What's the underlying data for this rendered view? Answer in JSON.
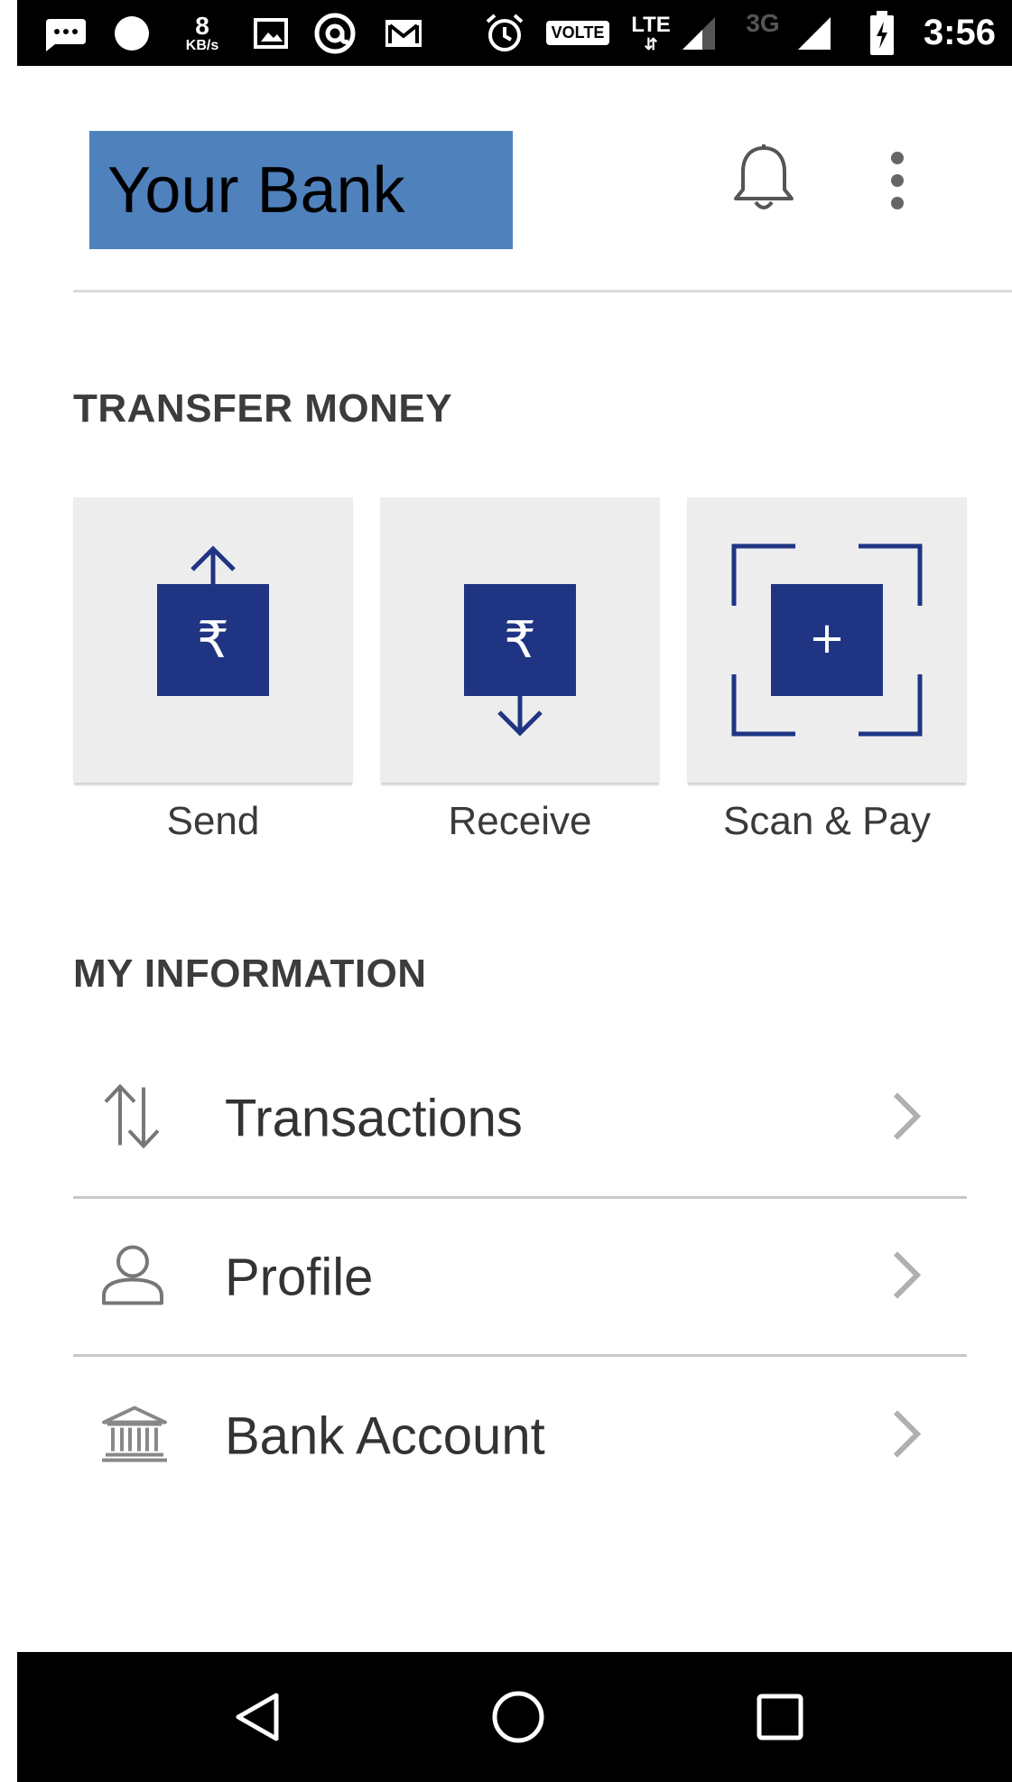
{
  "status_bar": {
    "network_speed_value": "8",
    "network_speed_unit": "KB/s",
    "volte_label": "VOLTE",
    "lte_label": "LTE",
    "secondary_network_label": "3G",
    "time": "3:56",
    "icons": [
      "message-icon",
      "circle-notification-icon",
      "image-icon",
      "at-sign-icon",
      "gmail-icon",
      "alarm-icon",
      "signal-icon",
      "battery-charging-icon"
    ]
  },
  "header": {
    "brand_name": "Your Bank",
    "brand_color": "#4f81bd",
    "icons": [
      "bell-icon",
      "more-vertical-icon"
    ]
  },
  "transfer_section": {
    "title": "TRANSFER MONEY",
    "tiles": [
      {
        "label": "Send",
        "icon": "send-rupee-icon",
        "symbol": "₹"
      },
      {
        "label": "Receive",
        "icon": "receive-rupee-icon",
        "symbol": "₹"
      },
      {
        "label": "Scan & Pay",
        "icon": "scan-qr-icon",
        "symbol": "+"
      }
    ],
    "accent_color": "#1f3584"
  },
  "info_section": {
    "title": "MY INFORMATION",
    "items": [
      {
        "label": "Transactions",
        "icon": "transactions-arrows-icon"
      },
      {
        "label": "Profile",
        "icon": "person-icon"
      },
      {
        "label": "Bank Account",
        "icon": "bank-building-icon"
      }
    ]
  },
  "nav_bar": {
    "icons": [
      "back-triangle-icon",
      "home-circle-icon",
      "recents-square-icon"
    ]
  }
}
